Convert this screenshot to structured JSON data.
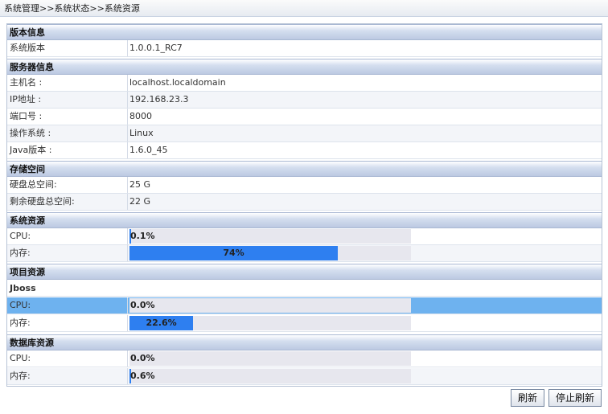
{
  "breadcrumb": "系统管理>>系统状态>>系统资源",
  "sections": {
    "version": {
      "title": "版本信息",
      "rows": [
        {
          "label": "系统版本",
          "value": "1.0.0.1_RC7"
        }
      ]
    },
    "server": {
      "title": "服务器信息",
      "rows": [
        {
          "label": "主机名 :",
          "value": "localhost.localdomain"
        },
        {
          "label": "IP地址 :",
          "value": "192.168.23.3"
        },
        {
          "label": "端口号 :",
          "value": "8000"
        },
        {
          "label": "操作系统 :",
          "value": "Linux"
        },
        {
          "label": "Java版本 :",
          "value": "1.6.0_45"
        }
      ]
    },
    "storage": {
      "title": "存储空间",
      "rows": [
        {
          "label": "硬盘总空间:",
          "value": "25 G"
        },
        {
          "label": "剩余硬盘总空间:",
          "value": "22 G"
        }
      ]
    },
    "system": {
      "title": "系统资源",
      "cpu": {
        "label": "CPU:",
        "text": "0.1%",
        "fraction": 0.001
      },
      "mem": {
        "label": "内存:",
        "text": "74%",
        "fraction": 0.74
      }
    },
    "project": {
      "title": "项目资源",
      "subtitle": "Jboss",
      "cpu": {
        "label": "CPU:",
        "text": "0.0%",
        "fraction": 0.0
      },
      "mem": {
        "label": "内存:",
        "text": "22.6%",
        "fraction": 0.226
      }
    },
    "database": {
      "title": "数据库资源",
      "cpu": {
        "label": "CPU:",
        "text": "0.0%",
        "fraction": 0.0
      },
      "mem": {
        "label": "内存:",
        "text": "0.6%",
        "fraction": 0.006
      }
    }
  },
  "buttons": {
    "refresh": "刷新",
    "stop_refresh": "停止刷新"
  },
  "colors": {
    "bar_fill": "#2e7ff0",
    "bar_track": "#e7e7ee",
    "selected_row": "#6eb2ef",
    "section_header": "#bcc9e2"
  }
}
